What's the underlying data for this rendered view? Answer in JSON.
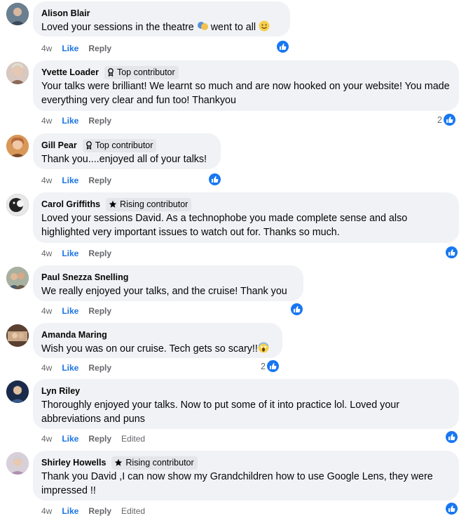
{
  "comments": [
    {
      "name": "Alison Blair",
      "badge": "",
      "text": "Loved your sessions in the theatre ",
      "text_after": " went to all ",
      "age": "4w",
      "like": "Like",
      "reply": "Reply",
      "edited": "",
      "reactions": "",
      "avatar_color": "#4a6072"
    },
    {
      "name": "Yvette Loader",
      "badge": "Top contributor",
      "text": "Your talks were brilliant! We learnt so much and are now hooked on your website! You made everything very clear and fun too! Thankyou",
      "age": "4w",
      "like": "Like",
      "reply": "Reply",
      "edited": "",
      "reactions": "2",
      "avatar_color": "#b59a8a"
    },
    {
      "name": "Gill Pear",
      "badge": "Top contributor",
      "text": "Thank you....enjoyed all of your talks!",
      "age": "4w",
      "like": "Like",
      "reply": "Reply",
      "edited": "",
      "reactions": "",
      "avatar_color": "#c98a4a"
    },
    {
      "name": "Carol Griffiths",
      "badge": "Rising contributor",
      "text": "Loved your sessions David. As a technophobe you made complete sense and also highlighted very important issues to watch out for. Thanks so much.",
      "age": "4w",
      "like": "Like",
      "reply": "Reply",
      "edited": "",
      "reactions": "",
      "avatar_color": "#2e2e2e"
    },
    {
      "name": "Paul Snezza Snelling",
      "badge": "",
      "text": "We really enjoyed your talks, and the cruise! Thank you",
      "age": "4w",
      "like": "Like",
      "reply": "Reply",
      "edited": "",
      "reactions": "",
      "avatar_color": "#8a7a6a"
    },
    {
      "name": "Amanda Maring",
      "badge": "",
      "text": "Wish you was on our cruise. Tech gets so scary!!",
      "age": "4w",
      "like": "Like",
      "reply": "Reply",
      "edited": "",
      "reactions": "2",
      "avatar_color": "#6a4a3a"
    },
    {
      "name": "Lyn Riley",
      "badge": "",
      "text": "Thoroughly enjoyed your talks. Now to put some of it into practice lol. Loved your abbreviations and puns",
      "age": "4w",
      "like": "Like",
      "reply": "Reply",
      "edited": "Edited",
      "reactions": "",
      "avatar_color": "#2a3a5a"
    },
    {
      "name": "Shirley Howells",
      "badge": "Rising contributor",
      "text": "Thank you David ,I can now show my Grandchildren how to use Google Lens, they were impressed !!",
      "age": "4w",
      "like": "Like",
      "reply": "Reply",
      "edited": "Edited",
      "reactions": "",
      "avatar_color": "#c8b8c8"
    }
  ],
  "colors": {
    "like_blue": "#1b74e4",
    "bubble_bg": "#f0f2f5",
    "meta_grey": "#65676b"
  },
  "icons": {
    "top_contributor": "ribbon-icon",
    "rising_contributor": "star-icon",
    "reaction": "thumbs-up-icon"
  }
}
